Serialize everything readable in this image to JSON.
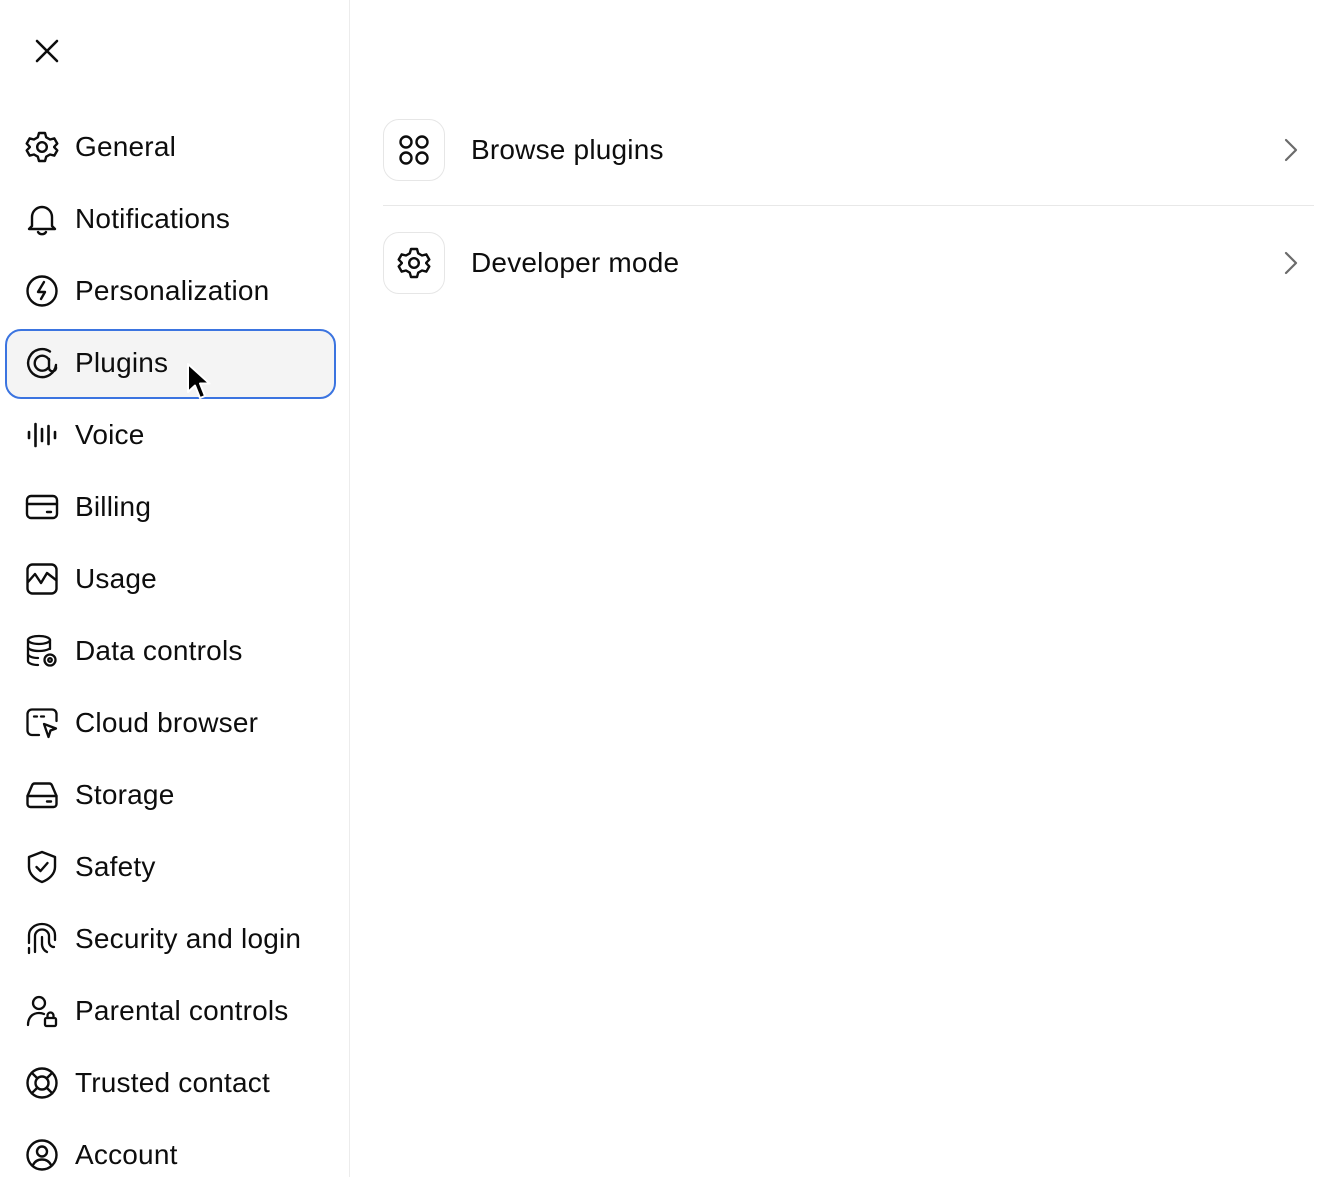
{
  "window": {
    "close_icon": "close-icon"
  },
  "sidebar": {
    "items": [
      {
        "label": "General",
        "icon": "gear-icon",
        "active": false
      },
      {
        "label": "Notifications",
        "icon": "bell-icon",
        "active": false
      },
      {
        "label": "Personalization",
        "icon": "personalization-icon",
        "active": false
      },
      {
        "label": "Plugins",
        "icon": "plugins-icon",
        "active": true
      },
      {
        "label": "Voice",
        "icon": "waveform-icon",
        "active": false
      },
      {
        "label": "Billing",
        "icon": "credit-card-icon",
        "active": false
      },
      {
        "label": "Usage",
        "icon": "chart-icon",
        "active": false
      },
      {
        "label": "Data controls",
        "icon": "database-gear-icon",
        "active": false
      },
      {
        "label": "Cloud browser",
        "icon": "browser-cursor-icon",
        "active": false
      },
      {
        "label": "Storage",
        "icon": "hard-drive-icon",
        "active": false
      },
      {
        "label": "Safety",
        "icon": "shield-check-icon",
        "active": false
      },
      {
        "label": "Security and login",
        "icon": "fingerprint-icon",
        "active": false
      },
      {
        "label": "Parental controls",
        "icon": "person-lock-icon",
        "active": false
      },
      {
        "label": "Trusted contact",
        "icon": "lifebuoy-icon",
        "active": false
      },
      {
        "label": "Account",
        "icon": "user-circle-icon",
        "active": false
      }
    ],
    "accent_color": "#3b74e0"
  },
  "main": {
    "rows": [
      {
        "label": "Browse plugins",
        "icon": "grid-circles-icon"
      },
      {
        "label": "Developer mode",
        "icon": "gear-icon"
      }
    ]
  }
}
